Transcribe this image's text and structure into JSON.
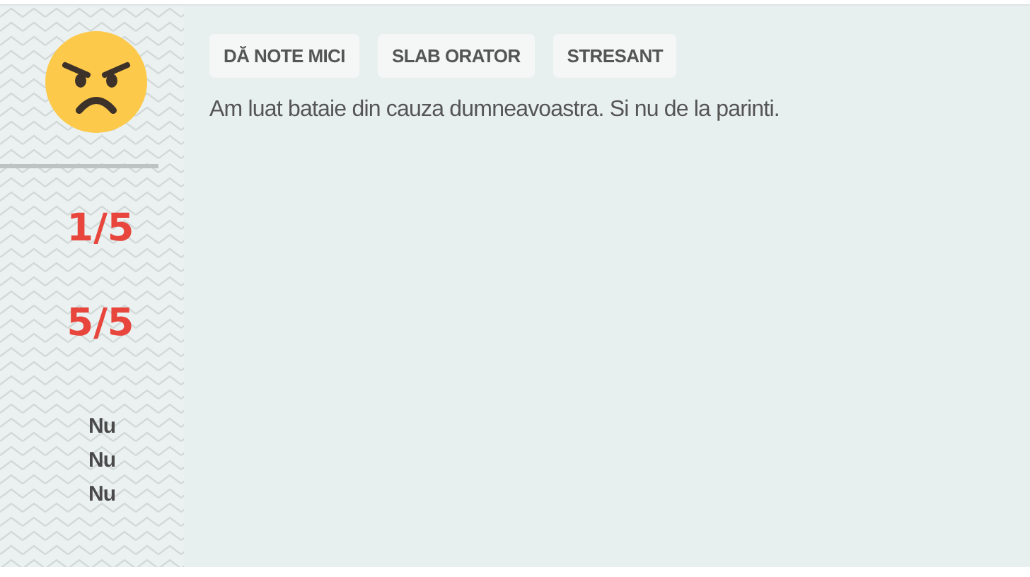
{
  "review": {
    "ratings": [
      "1/5",
      "5/5"
    ],
    "answers": [
      "Nu",
      "Nu",
      "Nu"
    ],
    "tags": [
      "DĂ NOTE MICI",
      "SLAB ORATOR",
      "STRESANT"
    ],
    "text": "Am luat bataie din cauza dumneavoastra. Si nu de la parinti."
  }
}
